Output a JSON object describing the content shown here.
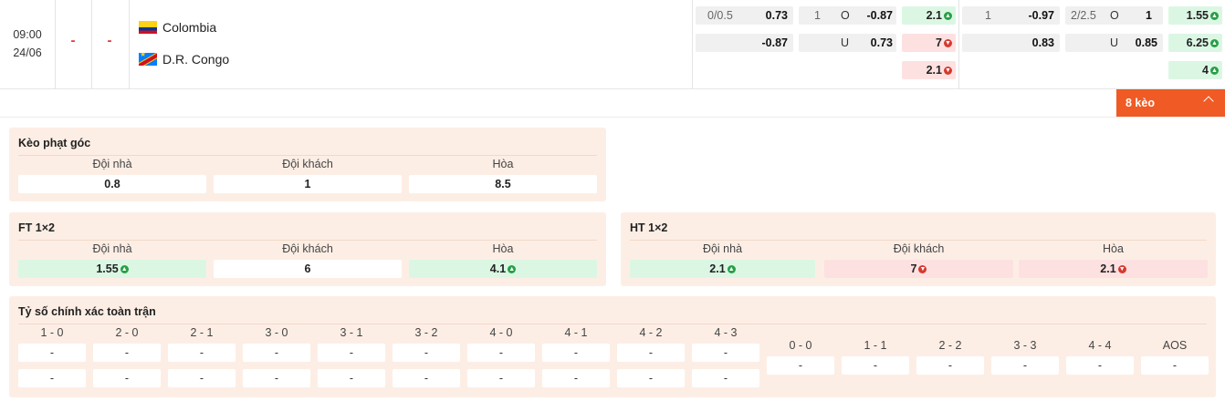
{
  "match": {
    "time": "09:00",
    "date": "24/06",
    "home_score": "-",
    "away_score": "-",
    "home_team": "Colombia",
    "away_team": "D.R. Congo"
  },
  "odds": {
    "ah_ft": {
      "line": "0/0.5",
      "home": "0.73",
      "away": "-0.87"
    },
    "ou_ft": {
      "line": "1",
      "over_label": "O",
      "over": "-0.87",
      "under_label": "U",
      "under": "0.73"
    },
    "x12_ft": {
      "home": "2.1",
      "away": "7",
      "draw": "2.1"
    },
    "ah_ht": {
      "line": "1",
      "home": "-0.97",
      "away": "0.83"
    },
    "ou_ht": {
      "line": "2/2.5",
      "over_label": "O",
      "over": "1",
      "under_label": "U",
      "under": "0.85"
    },
    "x12_ht": {
      "home": "1.55",
      "away": "6.25",
      "draw": "4"
    }
  },
  "more_button": "8 kèo",
  "corner": {
    "title": "Kèo phạt góc",
    "headers": [
      "Đội nhà",
      "Đội khách",
      "Hòa"
    ],
    "values": [
      "0.8",
      "1",
      "8.5"
    ]
  },
  "ft": {
    "title": "FT 1×2",
    "headers": [
      "Đội nhà",
      "Đội khách",
      "Hòa"
    ],
    "values": [
      "1.55",
      "6",
      "4.1"
    ]
  },
  "ht": {
    "title": "HT 1×2",
    "headers": [
      "Đội nhà",
      "Đội khách",
      "Hòa"
    ],
    "values": [
      "2.1",
      "7",
      "2.1"
    ]
  },
  "correct_score": {
    "title": "Tỷ số chính xác toàn trận",
    "home_scores": [
      "1 - 0",
      "2 - 0",
      "2 - 1",
      "3 - 0",
      "3 - 1",
      "3 - 2",
      "4 - 0",
      "4 - 1",
      "4 - 2",
      "4 - 3"
    ],
    "draw_scores": [
      "0 - 0",
      "1 - 1",
      "2 - 2",
      "3 - 3",
      "4 - 4",
      "AOS"
    ],
    "home_row1": [
      "-",
      "-",
      "-",
      "-",
      "-",
      "-",
      "-",
      "-",
      "-",
      "-"
    ],
    "home_row2": [
      "-",
      "-",
      "-",
      "-",
      "-",
      "-",
      "-",
      "-",
      "-",
      "-"
    ],
    "draw_row": [
      "-",
      "-",
      "-",
      "-",
      "-",
      "-"
    ]
  },
  "colors": {
    "accent": "#f05a24",
    "up": "#27a046",
    "down": "#d63a2f",
    "panel": "#fdeee5"
  },
  "icons": {
    "up": "arrow-up-circle-icon",
    "down": "arrow-down-circle-icon",
    "collapse": "chevron-up-icon"
  }
}
